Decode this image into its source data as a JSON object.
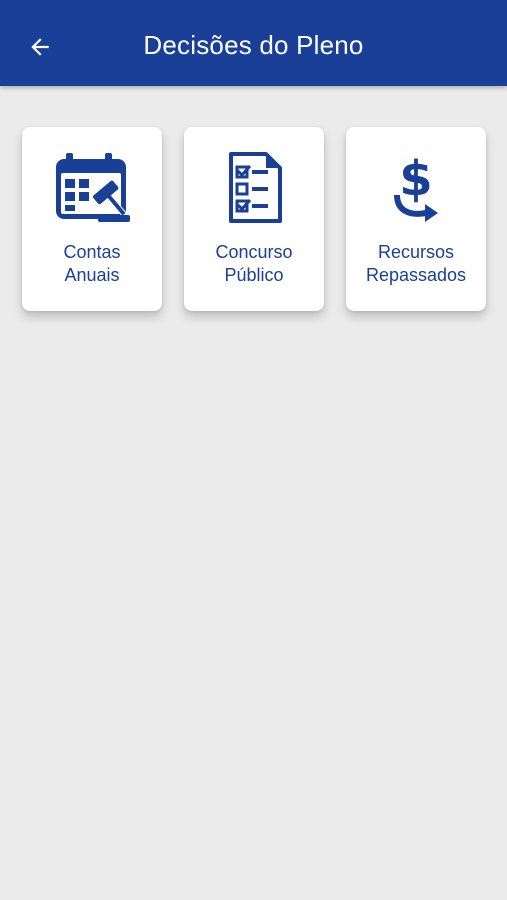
{
  "header": {
    "title": "Decisões do Pleno",
    "back_icon": "arrow-left-icon"
  },
  "colors": {
    "primary": "#1a3f96",
    "background": "#ebebeb",
    "card": "#ffffff"
  },
  "cards": [
    {
      "line1": "Contas",
      "line2": "Anuais",
      "icon": "calendar-gavel-icon"
    },
    {
      "line1": "Concurso",
      "line2": "Público",
      "icon": "checklist-document-icon"
    },
    {
      "line1": "Recursos",
      "line2": "Repassados",
      "icon": "dollar-transfer-icon"
    }
  ]
}
